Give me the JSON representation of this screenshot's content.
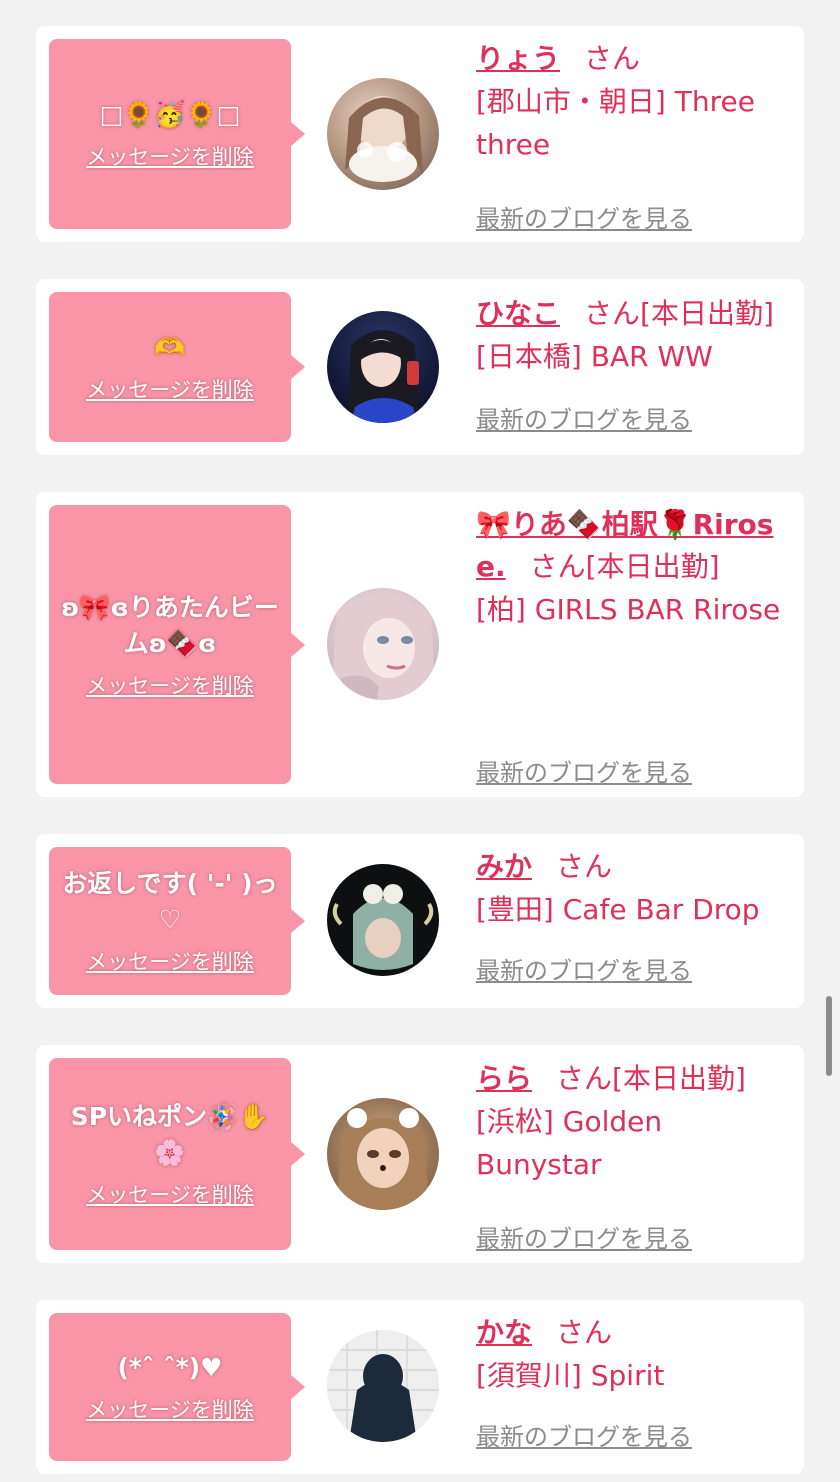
{
  "delete_label": "メッセージを削除",
  "blog_label": "最新のブログを見る",
  "san_label": "さん",
  "colors": {
    "accent": "#e0305a",
    "bubble": "#f995a6",
    "link_gray": "#8b8b8b",
    "background": "#f2f2f2"
  },
  "entries": [
    {
      "message": "□🌻🥳🌻□",
      "name": "りょう",
      "status": "",
      "shop": "[郡山市・朝日] Three three"
    },
    {
      "message": "🫶",
      "name": "ひなこ",
      "status": "[本日出勤]",
      "shop": "[日本橋] BAR WW"
    },
    {
      "message": "ʚ🎀ɞりあたんビームʚ🍫ɞ",
      "name": "🎀りあ🍫柏駅🌹Rirose.",
      "status": "[本日出勤]",
      "shop": "[柏] GIRLS BAR Rirose"
    },
    {
      "message": "お返しです( '-' )っ♡",
      "name": "みか",
      "status": "",
      "shop": "[豊田] Cafe Bar Drop"
    },
    {
      "message": "SPいねポン🪅✋🌸",
      "name": "らら",
      "status": "[本日出勤]",
      "shop": "[浜松] Golden Bunystar"
    },
    {
      "message": "(*ˆ ˆ*)♥",
      "name": "かな",
      "status": "",
      "shop": "[須賀川] Spirit"
    }
  ]
}
